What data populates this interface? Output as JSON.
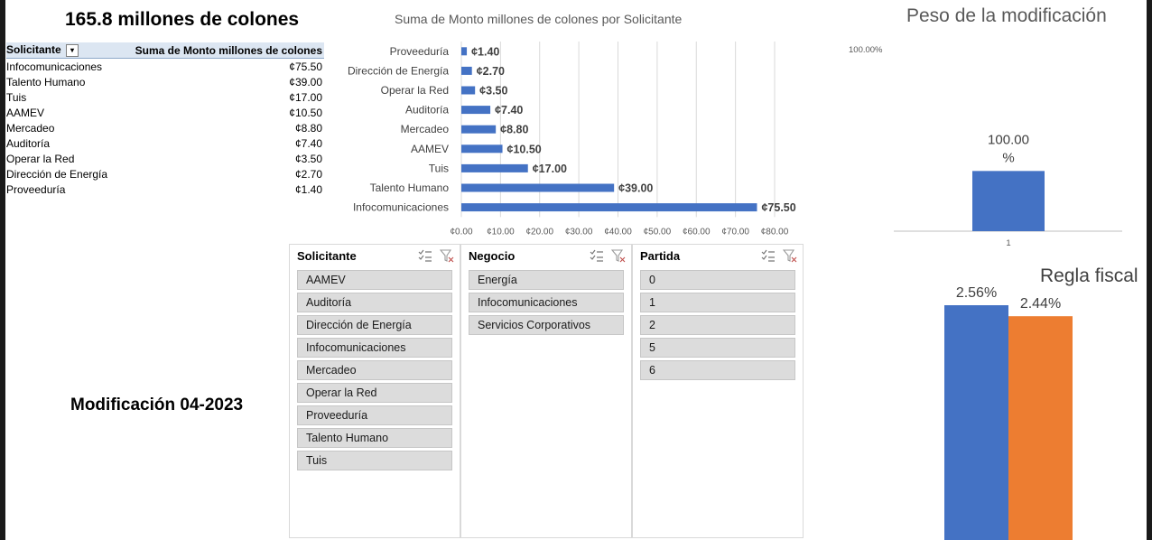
{
  "header": {
    "total_title": "165.8 millones de colones",
    "modification_title": "Modificación 04-2023"
  },
  "pivot": {
    "col_solicitante": "Solicitante",
    "col_suma": "Suma de Monto millones de colones",
    "rows": [
      {
        "name": "Infocomunicaciones",
        "value": "¢75.50"
      },
      {
        "name": "Talento Humano",
        "value": "¢39.00"
      },
      {
        "name": "Tuis",
        "value": "¢17.00"
      },
      {
        "name": "AAMEV",
        "value": "¢10.50"
      },
      {
        "name": "Mercadeo",
        "value": "¢8.80"
      },
      {
        "name": "Auditoría",
        "value": "¢7.40"
      },
      {
        "name": "Operar la Red",
        "value": "¢3.50"
      },
      {
        "name": "Dirección de Energía",
        "value": "¢2.70"
      },
      {
        "name": "Proveeduría",
        "value": "¢1.40"
      }
    ]
  },
  "slicers": {
    "solicitante": {
      "title": "Solicitante",
      "items": [
        "AAMEV",
        "Auditoría",
        "Dirección de Energía",
        "Infocomunicaciones",
        "Mercadeo",
        "Operar la Red",
        "Proveeduría",
        "Talento Humano",
        "Tuis"
      ]
    },
    "negocio": {
      "title": "Negocio",
      "items": [
        "Energía",
        "Infocomunicaciones",
        "Servicios Corporativos"
      ]
    },
    "partida": {
      "title": "Partida",
      "items": [
        "0",
        "1",
        "2",
        "5",
        "6"
      ]
    }
  },
  "colors": {
    "blue": "#4472c4",
    "orange": "#ed7d31",
    "pivot_header": "#dce6f2"
  },
  "chart_data": [
    {
      "type": "bar",
      "orientation": "horizontal",
      "title": "Suma de Monto millones de colones por Solicitante",
      "categories": [
        "Proveeduría",
        "Dirección de Energía",
        "Operar la Red",
        "Auditoría",
        "Mercadeo",
        "AAMEV",
        "Tuis",
        "Talento Humano",
        "Infocomunicaciones"
      ],
      "values": [
        1.4,
        2.7,
        3.5,
        7.4,
        8.8,
        10.5,
        17.0,
        39.0,
        75.5
      ],
      "data_labels": [
        "¢1.40",
        "¢2.70",
        "¢3.50",
        "¢7.40",
        "¢8.80",
        "¢10.50",
        "¢17.00",
        "¢39.00",
        "¢75.50"
      ],
      "xlim": [
        0,
        80
      ],
      "x_ticks": [
        "¢0.00",
        "¢10.00",
        "¢20.00",
        "¢30.00",
        "¢40.00",
        "¢50.00",
        "¢60.00",
        "¢70.00",
        "¢80.00"
      ],
      "grid": true,
      "color": "#4472c4"
    },
    {
      "type": "bar",
      "title": "Peso de la modificación",
      "categories": [
        "1"
      ],
      "values": [
        100.0
      ],
      "data_labels": [
        "100.00\n%"
      ],
      "y_tick": "100.00%",
      "ylim": [
        0,
        100
      ],
      "color": "#4472c4"
    },
    {
      "type": "bar",
      "title": "Regla fiscal",
      "categories": [
        ""
      ],
      "series": [
        {
          "values": [
            2.56
          ],
          "label": "2.56%",
          "color": "#4472c4"
        },
        {
          "values": [
            2.44
          ],
          "label": "2.44%",
          "color": "#ed7d31"
        }
      ]
    }
  ]
}
